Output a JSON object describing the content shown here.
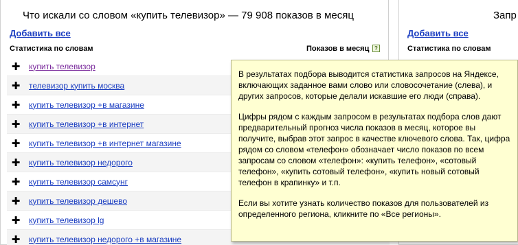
{
  "left_panel": {
    "title": "Что искали со словом «купить телевизор» — 79 908 показов в месяц",
    "add_all": "Добавить все",
    "col_words": "Статистика по словам",
    "col_shows": "Показов в месяц",
    "help_glyph": "?",
    "rows": [
      {
        "plus": "✚",
        "keyword": "купить телевизор"
      },
      {
        "plus": "✚",
        "keyword": "телевизор купить москва"
      },
      {
        "plus": "✚",
        "keyword": "купить телевизор +в магазине"
      },
      {
        "plus": "✚",
        "keyword": "купить телевизор +в интернет"
      },
      {
        "plus": "✚",
        "keyword": "купить телевизор +в интернет магазине"
      },
      {
        "plus": "✚",
        "keyword": "купить телевизор недорого"
      },
      {
        "plus": "✚",
        "keyword": "купить телевизор самсунг"
      },
      {
        "plus": "✚",
        "keyword": "купить телевизор дешево"
      },
      {
        "plus": "✚",
        "keyword": "купить телевизор lg"
      },
      {
        "plus": "✚",
        "keyword": "купить телевизор недорого +в магазине"
      }
    ]
  },
  "right_panel": {
    "title": "Запр",
    "add_all": "Добавить все",
    "col_words": "Статистика по словам"
  },
  "tooltip": {
    "p1": "В результатах подбора выводится статистика запросов на Яндексе, включающих заданное вами слово или словосочетание (слева), и других запросов, которые делали искавшие его люди (справа).",
    "p2": "Цифры рядом с каждым запросом в результатах подбора слов дают предварительный прогноз числа показов в месяц, которое вы получите, выбрав этот запрос в качестве ключевого слова. Так, цифра рядом со словом «телефон» обозначает число показов по всем запросам со словом «телефон»: «купить телефон», «сотовый телефон», «купить сотовый телефон», «купить новый сотовый телефон в крапинку» и т.п.",
    "p3": "Если вы хотите узнать количество показов для пользователей из определенного региона, кликните по «Все регионы»."
  },
  "colors": {
    "link": "#1a3dc1",
    "visited_link": "#7a2a9c",
    "tooltip_bg": "#ffffd2"
  }
}
